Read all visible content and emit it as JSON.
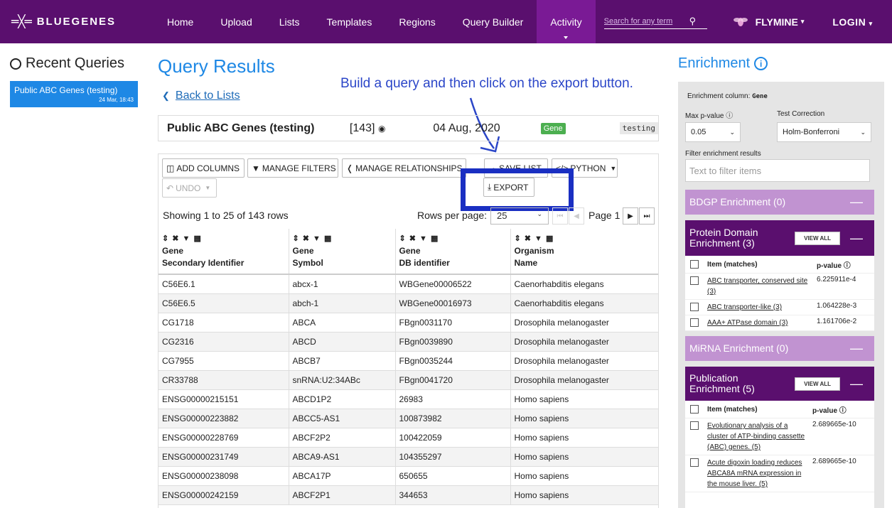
{
  "nav": {
    "logo": "═╳═",
    "brand": "BLUEGENES",
    "links": [
      "Home",
      "Upload",
      "Lists",
      "Templates",
      "Regions",
      "Query Builder",
      "Activity"
    ],
    "search_placeholder": "Search for any term",
    "mine": "FLYMINE",
    "login": "LOGIN"
  },
  "recent": {
    "title": "Recent Queries",
    "items": [
      {
        "name": "Public ABC Genes (testing)",
        "date": "24 Mar, 18:43"
      }
    ]
  },
  "main": {
    "title": "Query Results",
    "back": "Back to Lists",
    "annotation": "Build a query and then click on the export button.",
    "list": {
      "name": "Public ABC Genes (testing)",
      "count": "[143]",
      "date": "04 Aug, 2020",
      "type": "Gene",
      "tag": "testing"
    },
    "toolbar": {
      "add_columns": "ADD COLUMNS",
      "manage_filters": "MANAGE FILTERS",
      "manage_relationships": "MANAGE RELATIONSHIPS",
      "save_list": "SAVE LIST",
      "python": "PYTHON",
      "undo": "UNDO",
      "export": "EXPORT"
    },
    "showing": "Showing 1 to 25 of 143 rows",
    "rows_per_page_label": "Rows per page:",
    "rows_per_page": "25",
    "page": "Page 1",
    "columns": [
      {
        "l1": "Gene",
        "l2": "Secondary Identifier"
      },
      {
        "l1": "Gene",
        "l2": "Symbol"
      },
      {
        "l1": "Gene",
        "l2": "DB identifier"
      },
      {
        "l1": "Organism",
        "l2": "Name"
      }
    ],
    "rows": [
      [
        "C56E6.1",
        "abcx-1",
        "WBGene00006522",
        "Caenorhabditis elegans"
      ],
      [
        "C56E6.5",
        "abch-1",
        "WBGene00016973",
        "Caenorhabditis elegans"
      ],
      [
        "CG1718",
        "ABCA",
        "FBgn0031170",
        "Drosophila melanogaster"
      ],
      [
        "CG2316",
        "ABCD",
        "FBgn0039890",
        "Drosophila melanogaster"
      ],
      [
        "CG7955",
        "ABCB7",
        "FBgn0035244",
        "Drosophila melanogaster"
      ],
      [
        "CR33788",
        "snRNA:U2:34ABc",
        "FBgn0041720",
        "Drosophila melanogaster"
      ],
      [
        "ENSG00000215151",
        "ABCD1P2",
        "26983",
        "Homo sapiens"
      ],
      [
        "ENSG00000223882",
        "ABCC5-AS1",
        "100873982",
        "Homo sapiens"
      ],
      [
        "ENSG00000228769",
        "ABCF2P2",
        "100422059",
        "Homo sapiens"
      ],
      [
        "ENSG00000231749",
        "ABCA9-AS1",
        "104355297",
        "Homo sapiens"
      ],
      [
        "ENSG00000238098",
        "ABCA17P",
        "650655",
        "Homo sapiens"
      ],
      [
        "ENSG00000242159",
        "ABCF2P1",
        "344653",
        "Homo sapiens"
      ]
    ]
  },
  "enrichment": {
    "title": "Enrichment",
    "column_label": "Enrichment column:",
    "column_value": "Gene",
    "max_p_label": "Max p-value",
    "max_p": "0.05",
    "correction_label": "Test Correction",
    "correction": "Holm-Bonferroni",
    "filter_label": "Filter enrichment results",
    "filter_placeholder": "Text to filter items",
    "view_all": "VIEW ALL",
    "item_header": "Item (matches)",
    "p_header": "p-value",
    "sections": [
      {
        "title": "BDGP Enrichment (0)"
      },
      {
        "title": "Protein Domain Enrichment (3)",
        "items": [
          {
            "name": "ABC transporter, conserved site (3)",
            "p": "6.225911e-4"
          },
          {
            "name": "ABC transporter-like (3)",
            "p": "1.064228e-3"
          },
          {
            "name": "AAA+ ATPase domain (3)",
            "p": "1.161706e-2"
          }
        ]
      },
      {
        "title": "MiRNA Enrichment (0)"
      },
      {
        "title": "Publication Enrichment (5)",
        "items": [
          {
            "name": "Evolutionary analysis of a cluster of ATP-binding cassette (ABC) genes. (5)",
            "p": "2.689665e-10"
          },
          {
            "name": "Acute digoxin loading reduces ABCA8A mRNA expression in the mouse liver. (5)",
            "p": "2.689665e-10"
          }
        ]
      }
    ]
  }
}
